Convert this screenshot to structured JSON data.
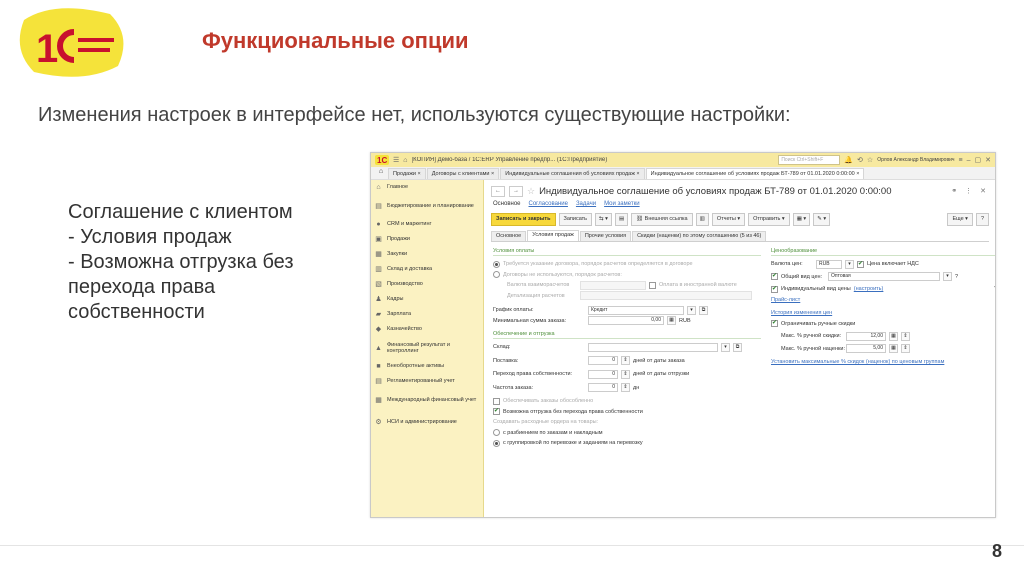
{
  "slide": {
    "title": "Функциональные опции",
    "subtitle": "Изменения настроек в интерфейсе нет, используются существующие настройки:",
    "bullets": [
      "Соглашение с клиентом",
      "- Условия продаж",
      "- Возможна отгрузка без",
      "перехода права",
      "собственности"
    ],
    "page_number": "8",
    "logo_text": "1С"
  },
  "window": {
    "title": "[КОПИЯ] Демо-база / 1С:ERP Управление предпр... (1С:Предприятие)",
    "search_placeholder": "Поиск Ctrl+Shift+F",
    "user": "Орлов Александр Владимирович",
    "open_tabs": [
      "Продажи",
      "Договоры с клиентами",
      "Индивидуальные соглашения об условиях продаж",
      "Индивидуальное соглашение об условиях продаж БТ-789 от 01.01.2020 0:00:00"
    ]
  },
  "sidebar": {
    "items": [
      {
        "label": "Главное",
        "icon": "home-icon"
      },
      {
        "label": "Бюджетирование и планирование",
        "icon": "chart-icon"
      },
      {
        "label": "CRM и маркетинг",
        "icon": "crm-icon"
      },
      {
        "label": "Продажи",
        "icon": "cart-icon"
      },
      {
        "label": "Закупки",
        "icon": "truck-icon"
      },
      {
        "label": "Склад и доставка",
        "icon": "warehouse-icon"
      },
      {
        "label": "Производство",
        "icon": "factory-icon"
      },
      {
        "label": "Кадры",
        "icon": "people-icon"
      },
      {
        "label": "Зарплата",
        "icon": "salary-icon"
      },
      {
        "label": "Казначейство",
        "icon": "treasury-icon"
      },
      {
        "label": "Финансовый результат и контроллинг",
        "icon": "finance-icon"
      },
      {
        "label": "Внеоборотные активы",
        "icon": "assets-icon"
      },
      {
        "label": "Регламентированный учет",
        "icon": "accounting-icon"
      },
      {
        "label": "Международный финансовый учет",
        "icon": "intl-icon"
      },
      {
        "label": "НСИ и администрирование",
        "icon": "gear-icon"
      }
    ]
  },
  "form": {
    "title": "Индивидуальное соглашение об условиях продаж БТ-789 от 01.01.2020 0:00:00",
    "links": [
      "Основное",
      "Согласование",
      "Задачи",
      "Мои заметки"
    ],
    "toolbar": {
      "save_close": "Записать и закрыть",
      "save": "Записать",
      "external_link": "Внешняя ссылка",
      "reports": "Отчеты",
      "send": "Отправить",
      "more": "Еще",
      "help": "?"
    },
    "tabs": [
      "Основное",
      "Условия продаж",
      "Прочие условия",
      "Скидки (наценки) по этому соглашению (5 из 46)"
    ],
    "payment": {
      "section": "Условия оплаты",
      "opt1": "Требуется указание договора, порядок расчетов определяется в договоре",
      "opt2": "Договоры не используются, порядок расчетов:",
      "detail1": "Валюта взаиморасчетов",
      "detail1_check": "Оплата в иностранной валюте",
      "detail2": "Детализация расчетов",
      "schedule_label": "График оплаты:",
      "schedule_value": "Кредит",
      "min_sum_label": "Минимальная сумма заказа:",
      "min_sum_value": "0,00",
      "min_sum_currency": "RUB"
    },
    "shipment": {
      "section": "Обеспечение и отгрузка",
      "warehouse_label": "Склад:",
      "delivery_label": "Поставка:",
      "delivery_value": "0",
      "delivery_unit": "дней от даты заказа",
      "ownership_label": "Переход права собственности:",
      "ownership_value": "0",
      "ownership_unit": "дней от даты отгрузки",
      "frequency_label": "Частота заказа:",
      "frequency_value": "0",
      "frequency_unit": "дн",
      "mandatory": "Обеспечивать заказы обособленно",
      "no_ownership": "Возможна отгрузка без перехода права собственности",
      "split_label": "Создавать расходные ордера на товары:",
      "split1": "с разбиением по заказам и накладным",
      "split2": "с группировкой по перевозке и заданиям на перевозку"
    },
    "pricing": {
      "section": "Ценообразование",
      "currency_label": "Валюта цен:",
      "currency_value": "RUB",
      "vat_label": "Цена включает НДС",
      "price_type_label": "Общий вид цен:",
      "price_type_value": "Оптовая",
      "individual_label": "Индивидуальный вид цены",
      "setup_link": "(настроить)",
      "pricelist_link": "Прайс-лист",
      "history_link": "История изменения цен",
      "limit_label": "Ограничивать ручные скидки",
      "max_discount_label": "Макс. % ручной скидки:",
      "max_discount_value": "12,00",
      "max_markup_label": "Макс. % ручной наценки:",
      "max_markup_value": "5,00",
      "bottom_link": "Установить максимальные % скидок (наценок) по ценовым группам"
    }
  }
}
